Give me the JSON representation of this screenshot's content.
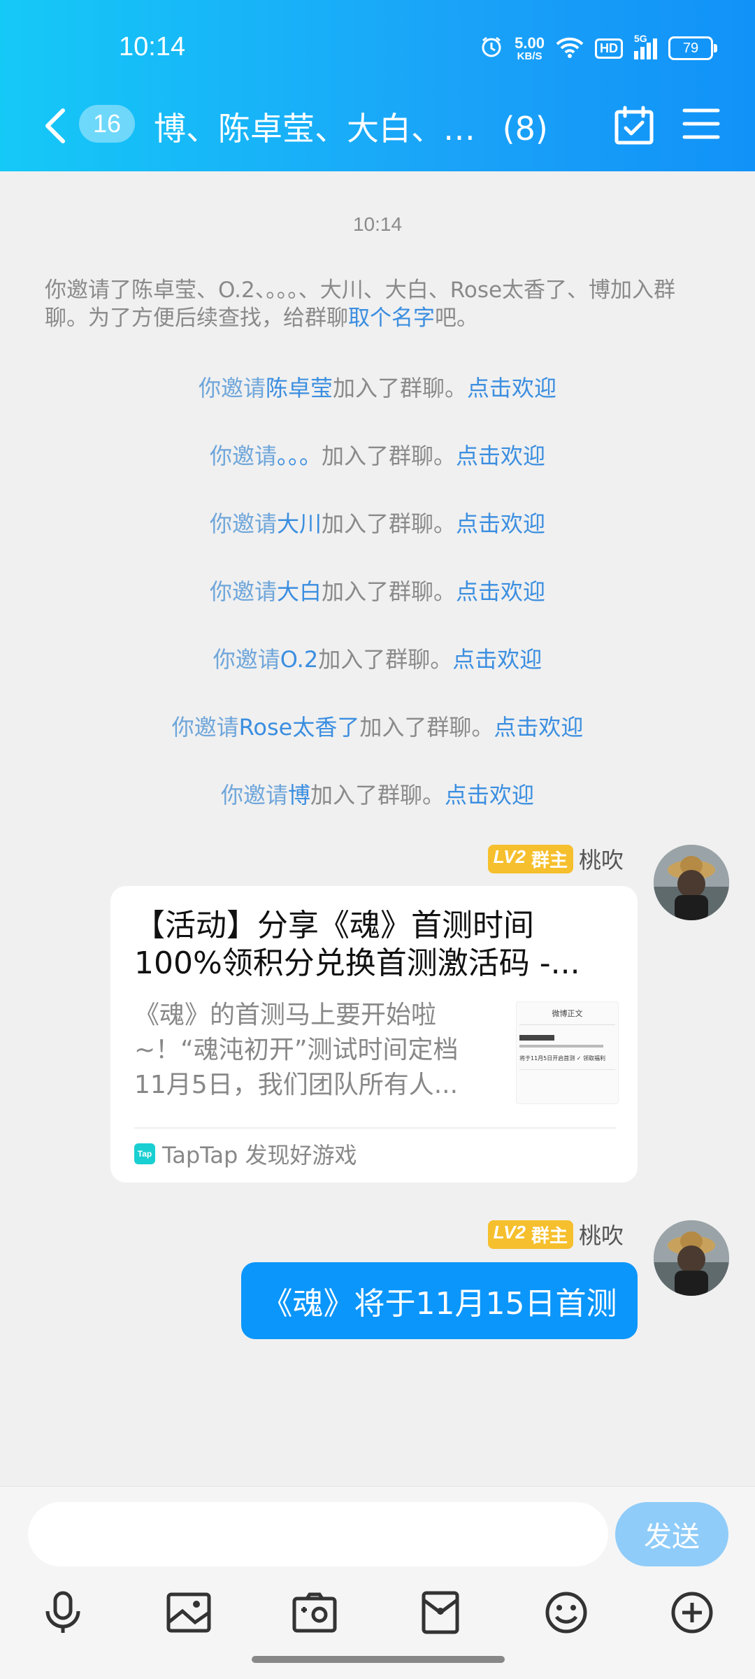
{
  "status_bar": {
    "time": "10:14",
    "net_speed_value": "5.00",
    "net_speed_unit": "KB/S",
    "hd_label": "HD",
    "network_label": "5G",
    "battery": "79"
  },
  "nav": {
    "unread_count": "16",
    "title": "博、陈卓莹、大白、…",
    "member_count": "(8)"
  },
  "chat": {
    "timestamp": "10:14",
    "system_notice": {
      "prefix": "你邀请了陈卓莹、O.2、。。。、大川、大白、Rose太香了、博加入群聊。为了方便后续查找，给群聊",
      "link": "取个名字",
      "suffix": "吧。"
    },
    "join_you": "你邀请",
    "join_mid": "加入了群聊。",
    "join_welcome": "点击欢迎",
    "join_names": [
      "陈卓莹",
      "。。。",
      "大川",
      "大白",
      "O.2",
      "Rose太香了",
      "博"
    ],
    "messages": [
      {
        "level": "LV2",
        "role": "群主",
        "sender": "桃吹",
        "card_title": "【活动】分享《魂》首测时间100%领积分兑换首测激活码 -...",
        "card_desc": "《魂》的首测马上要开始啦~！“魂沌初开”测试时间定档11月5日，我们团队所有人...",
        "thumb_title": "微博正文",
        "thumb_line": "将于11月5日开启首测 ✓ 领取福利",
        "card_source_icon": "Tap",
        "card_source": "TapTap 发现好游戏"
      },
      {
        "level": "LV2",
        "role": "群主",
        "sender": "桃吹",
        "text": "《魂》将于11月15日首测"
      }
    ]
  },
  "input": {
    "placeholder": "",
    "send_label": "发送"
  },
  "toolbar": {
    "icons": [
      "microphone-icon",
      "image-icon",
      "camera-icon",
      "red-packet-icon",
      "emoji-icon",
      "plus-icon"
    ]
  },
  "colors": {
    "header_start": "#15c9f7",
    "header_end": "#1192f8",
    "link_blue": "#3b8ee0",
    "bubble_blue": "#0b96fb",
    "badge_gold": "#f6bf2d"
  }
}
